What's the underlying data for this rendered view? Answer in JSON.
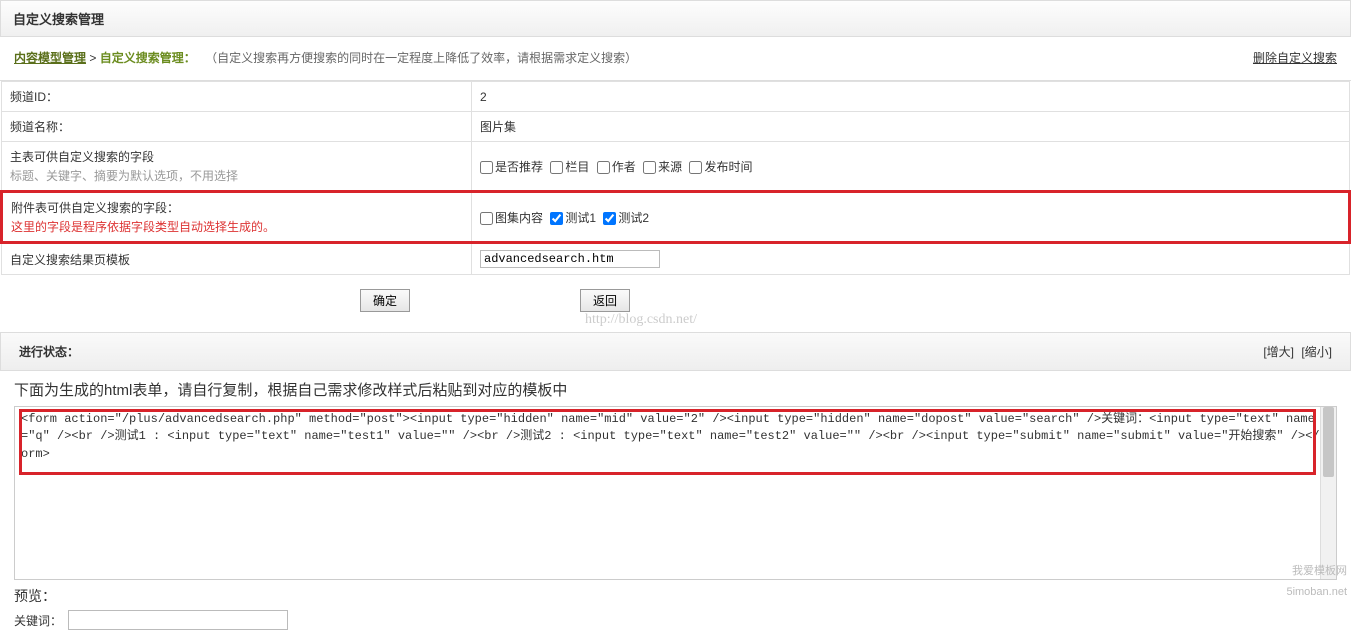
{
  "header": {
    "title": "自定义搜索管理"
  },
  "breadcrumb": {
    "root": "内容模型管理",
    "sep": ">",
    "current": "自定义搜索管理：",
    "desc": "（自定义搜索再方便搜索的同时在一定程度上降低了效率，请根据需求定义搜索）",
    "delete": "删除自定义搜索"
  },
  "rows": {
    "channel_id": {
      "label": "频道ID：",
      "value": "2"
    },
    "channel_name": {
      "label": "频道名称：",
      "value": "图片集"
    },
    "main_fields": {
      "label": "主表可供自定义搜索的字段",
      "sub": "标题、关键字、摘要为默认选项，不用选择",
      "options": [
        "是否推荐",
        "栏目",
        "作者",
        "来源",
        "发布时间"
      ]
    },
    "attach_fields": {
      "label": "附件表可供自定义搜索的字段：",
      "sub": "这里的字段是程序依据字段类型自动选择生成的。",
      "options": [
        {
          "label": "图集内容",
          "checked": false
        },
        {
          "label": "测试1",
          "checked": true
        },
        {
          "label": "测试2",
          "checked": true
        }
      ]
    },
    "template": {
      "label": "自定义搜索结果页模板",
      "value": "advancedsearch.htm"
    }
  },
  "buttons": {
    "ok": "确定",
    "back": "返回"
  },
  "progress": {
    "label": "进行状态：",
    "enlarge": "[增大]",
    "shrink": "[缩小]"
  },
  "watermark": "http://blog.csdn.net/",
  "result": {
    "title": "下面为生成的html表单，请自行复制，根据自己需求修改样式后粘贴到对应的模板中",
    "code": "<form action=\"/plus/advancedsearch.php\" method=\"post\"><input type=\"hidden\" name=\"mid\" value=\"2\" /><input type=\"hidden\" name=\"dopost\" value=\"search\" />关键词：<input type=\"text\" name=\"q\" /><br />测试1 : <input type=\"text\" name=\"test1\" value=\"\" /><br />测试2 : <input type=\"text\" name=\"test2\" value=\"\" /><br /><input type=\"submit\" name=\"submit\" value=\"开始搜索\" /></form>",
    "preview_label": "预览：",
    "keyword_label": "关键词："
  },
  "footer": {
    "credit": "我爱模板网",
    "domain": "5imoban.net"
  }
}
